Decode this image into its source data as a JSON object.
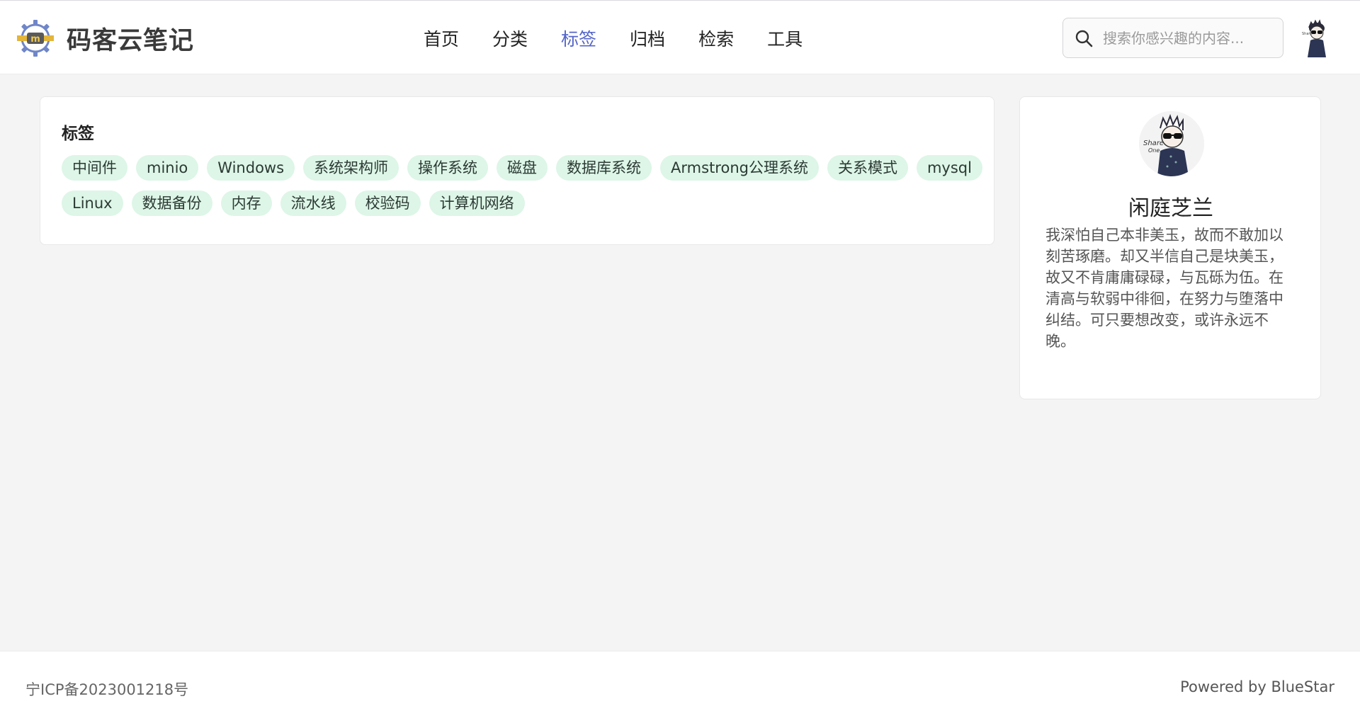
{
  "brand": {
    "name": "码客云笔记"
  },
  "nav": {
    "items": [
      {
        "label": "首页"
      },
      {
        "label": "分类"
      },
      {
        "label": "标签"
      },
      {
        "label": "归档"
      },
      {
        "label": "检索"
      },
      {
        "label": "工具"
      }
    ],
    "active_index": 2
  },
  "search": {
    "placeholder": "搜索你感兴趣的内容..."
  },
  "tags_card": {
    "title": "标签",
    "tags": [
      "中间件",
      "minio",
      "Windows",
      "系统架构师",
      "操作系统",
      "磁盘",
      "数据库系统",
      "Armstrong公理系统",
      "关系模式",
      "mysql",
      "Linux",
      "数据备份",
      "内存",
      "流水线",
      "校验码",
      "计算机网络"
    ]
  },
  "profile": {
    "name": "闲庭芝兰",
    "bio": "我深怕自己本非美玉，故而不敢加以刻苦琢磨。却又半信自己是块美玉，故又不肯庸庸碌碌，与瓦砾为伍。在清高与软弱中徘徊，在努力与堕落中纠结。可只要想改变，或许永远不晚。"
  },
  "footer": {
    "icp": "宁ICP备2023001218号",
    "powered": "Powered by BlueStar"
  },
  "colors": {
    "accent": "#5465c9",
    "tag_bg": "#ddf6e7",
    "page_bg": "#f4f4f4"
  },
  "icons": {
    "logo": "gear-logo-icon",
    "search": "search-icon",
    "avatar": "avatar-illustration"
  }
}
